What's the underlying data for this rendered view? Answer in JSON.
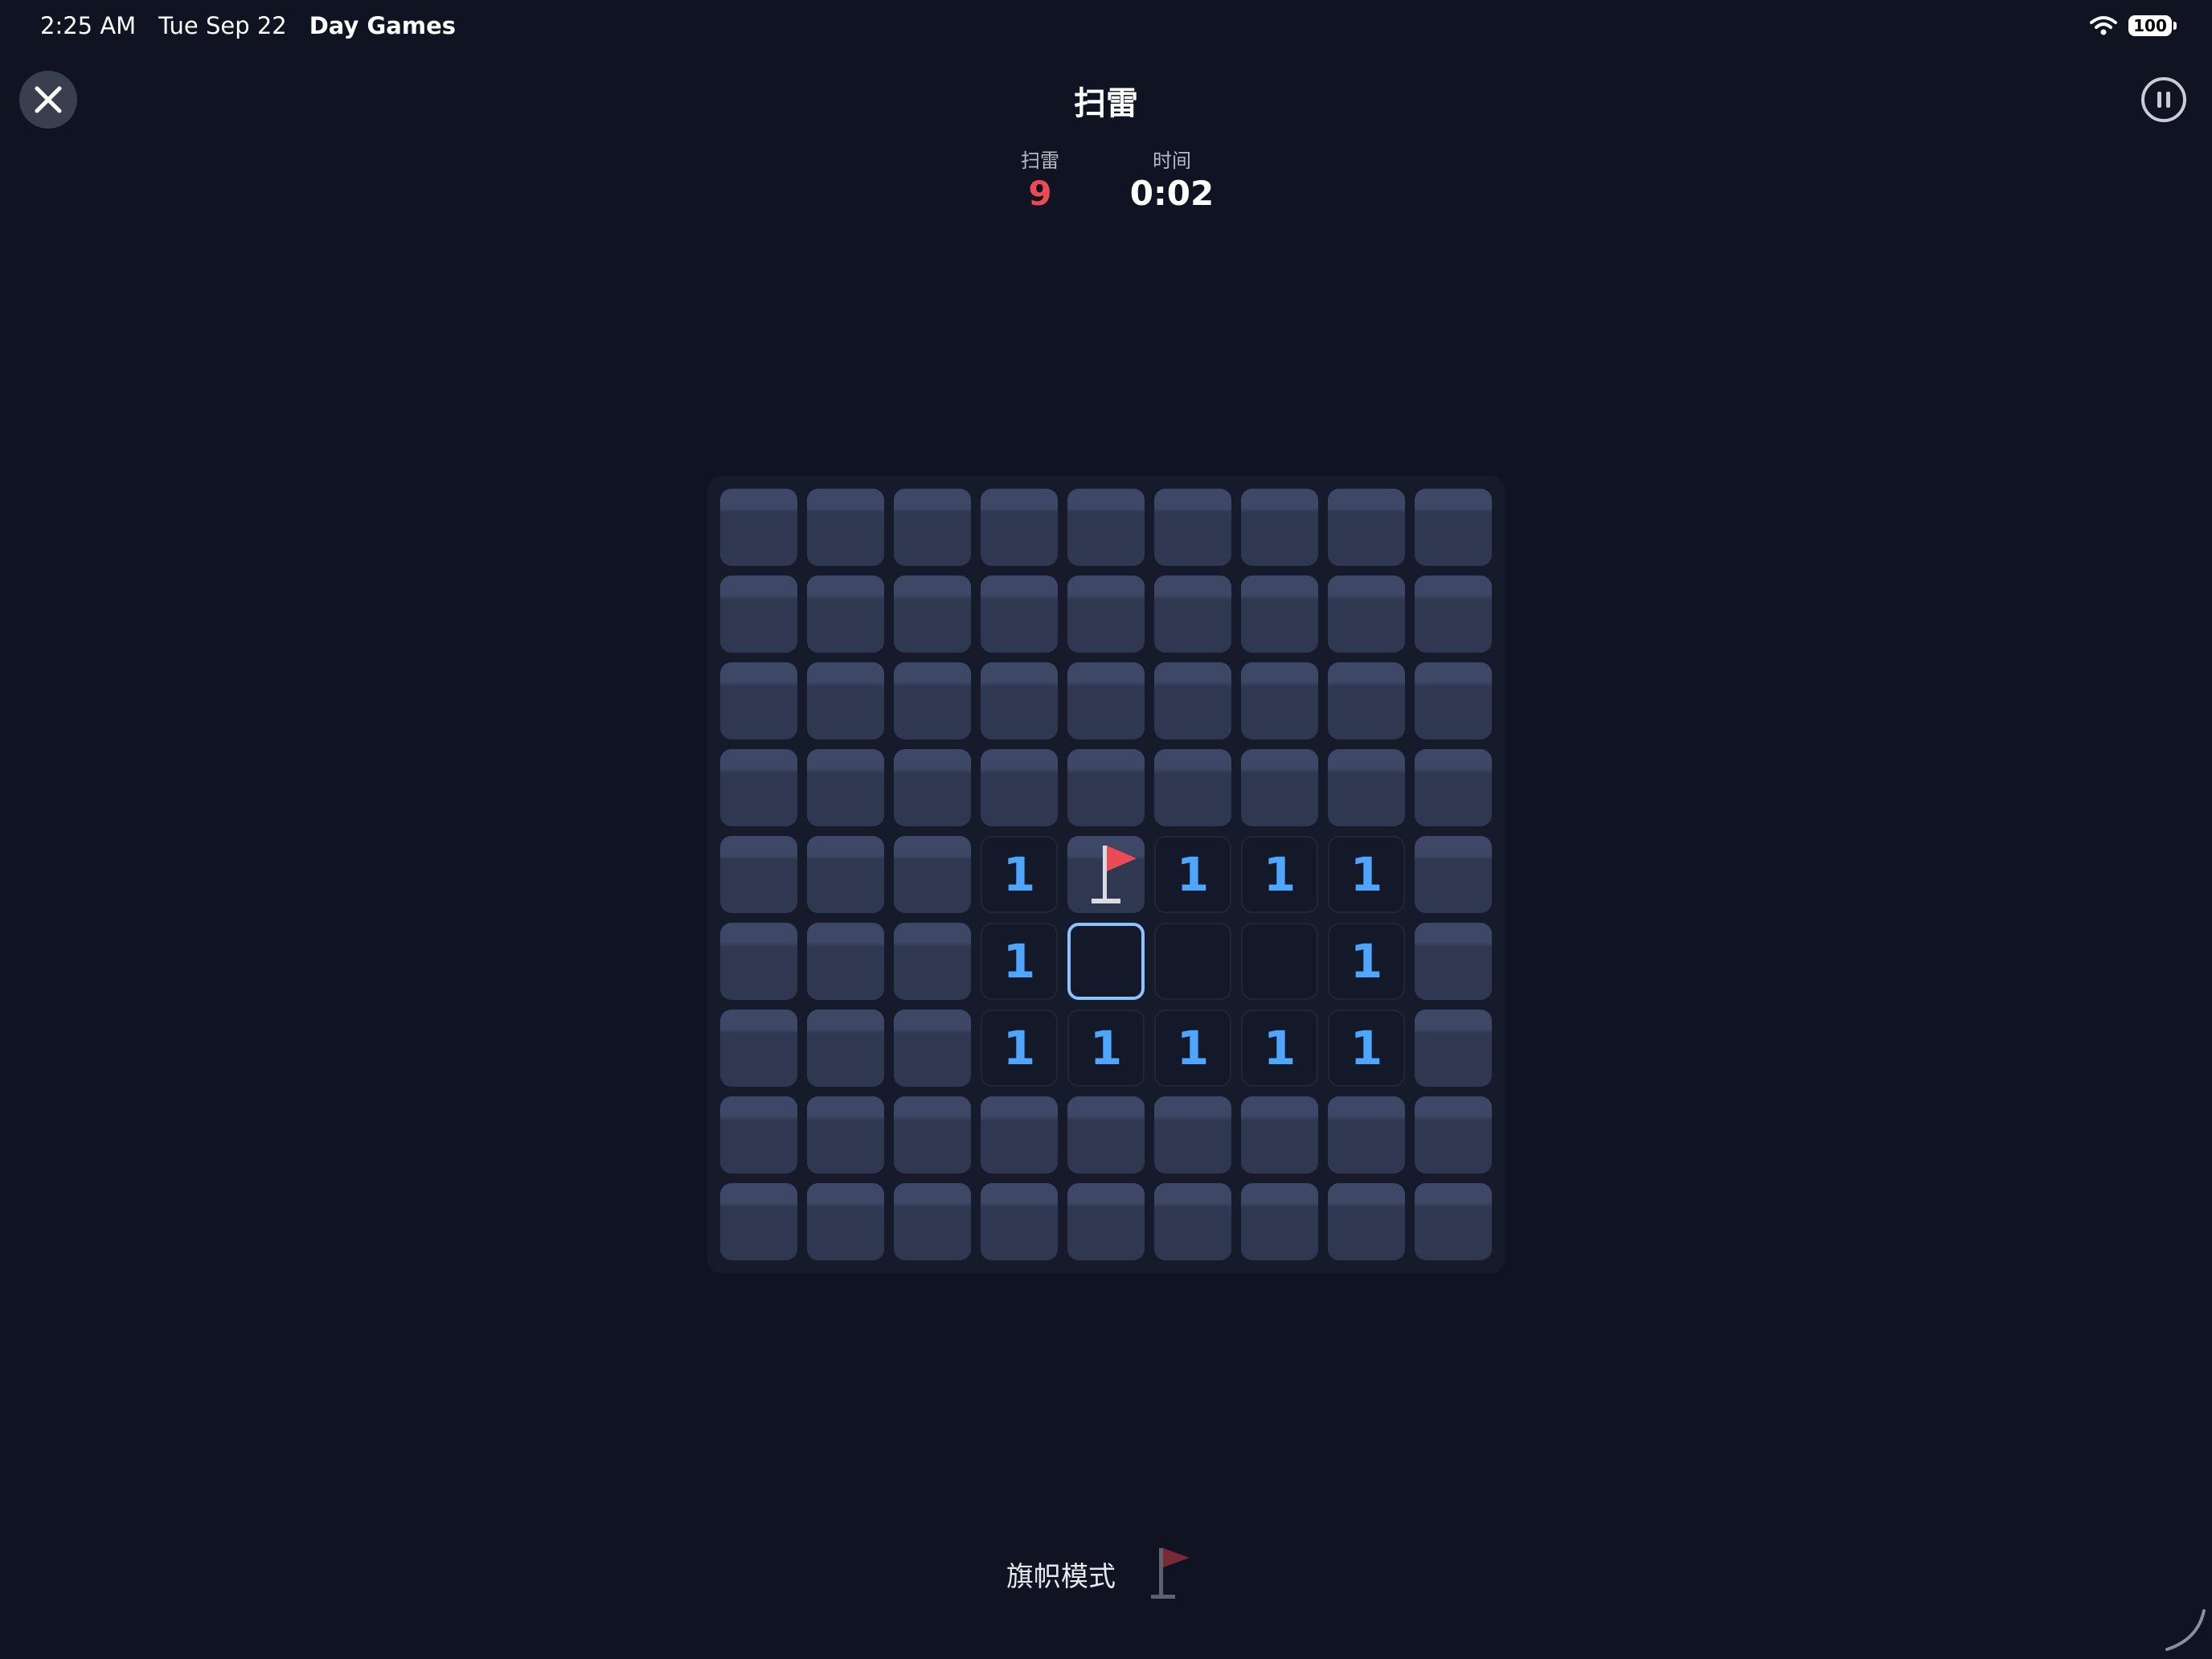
{
  "status_bar": {
    "time": "2:25 AM",
    "date": "Tue Sep 22",
    "app_name": "Day Games",
    "battery": "100"
  },
  "header": {
    "title": "扫雷",
    "close_icon": "close-icon",
    "pause_icon": "pause-icon"
  },
  "stats": {
    "mines_label": "扫雷",
    "mines_value": "9",
    "time_label": "时间",
    "time_value": "0:02"
  },
  "board": {
    "rows": 9,
    "cols": 9,
    "cells": [
      [
        "c",
        "c",
        "c",
        "c",
        "c",
        "c",
        "c",
        "c",
        "c"
      ],
      [
        "c",
        "c",
        "c",
        "c",
        "c",
        "c",
        "c",
        "c",
        "c"
      ],
      [
        "c",
        "c",
        "c",
        "c",
        "c",
        "c",
        "c",
        "c",
        "c"
      ],
      [
        "c",
        "c",
        "c",
        "c",
        "c",
        "c",
        "c",
        "c",
        "c"
      ],
      [
        "c",
        "c",
        "c",
        "1",
        "f",
        "1",
        "1",
        "1",
        "c"
      ],
      [
        "c",
        "c",
        "c",
        "1",
        "s",
        "0",
        "0",
        "1",
        "c"
      ],
      [
        "c",
        "c",
        "c",
        "1",
        "1",
        "1",
        "1",
        "1",
        "c"
      ],
      [
        "c",
        "c",
        "c",
        "c",
        "c",
        "c",
        "c",
        "c",
        "c"
      ],
      [
        "c",
        "c",
        "c",
        "c",
        "c",
        "c",
        "c",
        "c",
        "c"
      ]
    ],
    "number_color": "#4fa6ff",
    "flag_color": "#ec4b56"
  },
  "flag_mode": {
    "label": "旗帜模式",
    "icon": "flag-icon",
    "flag_color": "#7a2a35"
  }
}
